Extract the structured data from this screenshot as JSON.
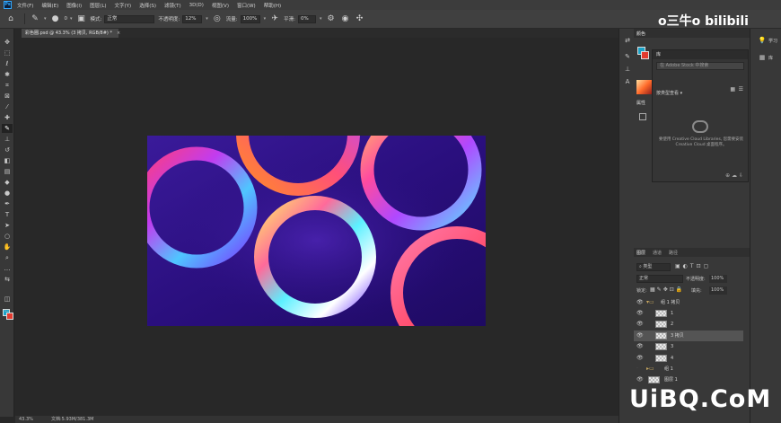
{
  "menu": {
    "app_icon": "Ps",
    "items": [
      "文件(F)",
      "编辑(E)",
      "图像(I)",
      "图层(L)",
      "文字(Y)",
      "选择(S)",
      "滤镜(T)",
      "3D(D)",
      "视图(V)",
      "窗口(W)",
      "帮助(H)"
    ]
  },
  "options": {
    "brush_size": "0",
    "mode_label": "模式:",
    "mode_value": "正常",
    "opacity_label": "不透明度:",
    "opacity_value": "12%",
    "flow_label": "流量:",
    "flow_value": "100%",
    "smoothing_label": "平滑:",
    "smoothing_value": "0%"
  },
  "document_tab": {
    "title": "彩色圈.psd @ 43.3% (3 拷贝, RGB/8#) *",
    "close": "×"
  },
  "status": {
    "zoom": "43.3%",
    "doc_info": "文档:5.93M/381.3M"
  },
  "panels": {
    "color_tab": "颜色",
    "properties_tab": "属性",
    "library": {
      "tab": "库",
      "search_placeholder": "在 Adobe Stock 中搜索",
      "dropdown": "按类型查看 ▾",
      "message": "要使用 Creative Cloud Libraries, 您需要安装 Creative Cloud 桌面程序。"
    },
    "learn_tab": "学习",
    "library_side_tab": "库",
    "layers": {
      "tabs": [
        "图层",
        "通道",
        "路径"
      ],
      "kind_filter": "类型",
      "blend_mode": "正常",
      "opacity_label": "不透明度:",
      "opacity_value": "100%",
      "lock_label": "锁定:",
      "fill_label": "填充:",
      "fill_value": "100%",
      "rows": [
        {
          "name": "组 1 拷贝",
          "type": "group",
          "visible": true,
          "selected": false
        },
        {
          "name": "1",
          "type": "layer",
          "visible": true,
          "selected": false
        },
        {
          "name": "2",
          "type": "layer",
          "visible": true,
          "selected": false
        },
        {
          "name": "3 拷贝",
          "type": "layer",
          "visible": true,
          "selected": true
        },
        {
          "name": "3",
          "type": "layer",
          "visible": true,
          "selected": false
        },
        {
          "name": "4",
          "type": "layer",
          "visible": true,
          "selected": false
        },
        {
          "name": "组 1",
          "type": "group",
          "visible": false,
          "selected": false
        },
        {
          "name": "图层 1",
          "type": "layer",
          "visible": true,
          "selected": false
        }
      ]
    }
  },
  "watermarks": {
    "top": "o三牛o bilibili",
    "bottom": "UiBQ.CoM"
  }
}
